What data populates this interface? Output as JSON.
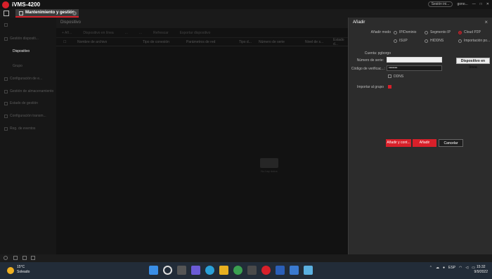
{
  "app": {
    "title": "iVMS-4200",
    "session_label": "Sesión ini...",
    "user_label": "gono..."
  },
  "tabs": [
    {
      "label": "Mantenimiento y gestión"
    }
  ],
  "sidebar": {
    "items": [
      {
        "label": "Gestión dispositi..."
      },
      {
        "label": "Dispositivo"
      },
      {
        "label": "Grupo"
      },
      {
        "label": "Configuración de e..."
      },
      {
        "label": "Gestión de almacenamiento"
      },
      {
        "label": "Estado de gestión"
      },
      {
        "label": "Configuración transm..."
      },
      {
        "label": "Reg. de eventos"
      }
    ]
  },
  "main": {
    "title": "Dispositivo",
    "toolbar": [
      "+ Añ...",
      "Dispositivo en línea",
      "...",
      "...",
      "Refrescar",
      "Exportar dispositivo"
    ],
    "columns": [
      "Nombre de archivo",
      "Tipo de conexión",
      "Parámetros de red",
      "Tipo d...",
      "Número de serie",
      "Nivel de s...",
      "Estado d..."
    ],
    "empty_text": "No hay datos"
  },
  "dialog": {
    "title": "Añadir",
    "mode_label": "Añadir modo",
    "modes": [
      {
        "label": "IP/Dominio",
        "selected": false
      },
      {
        "label": "Segmento IP",
        "selected": false
      },
      {
        "label": "Cloud P2P",
        "selected": true
      },
      {
        "label": "ISUP",
        "selected": false
      },
      {
        "label": "HIDDNS",
        "selected": false
      },
      {
        "label": "Importación po...",
        "selected": false
      }
    ],
    "account_label": "Cuenta: pgborgo",
    "serial_label": "Número de serie:",
    "serial_value": "|",
    "verif_label": "Código de verificac...:",
    "verif_value": "•••••••",
    "online_button": "Dispositivo en línea",
    "ddns_label": "DDNS",
    "import_group_label": "Importar al grupo",
    "add_continue": "Añadir y cont...",
    "add": "Añadir",
    "cancel": "Cancelar"
  },
  "taskbar": {
    "temp": "15°C",
    "weather_text": "Soleado",
    "lang": "ESP",
    "time": "15:32",
    "date": "9/9/2022"
  },
  "colors": {
    "accent": "#d8202a",
    "taskbar": "#222c38",
    "dialog": "#2c2c2c"
  }
}
